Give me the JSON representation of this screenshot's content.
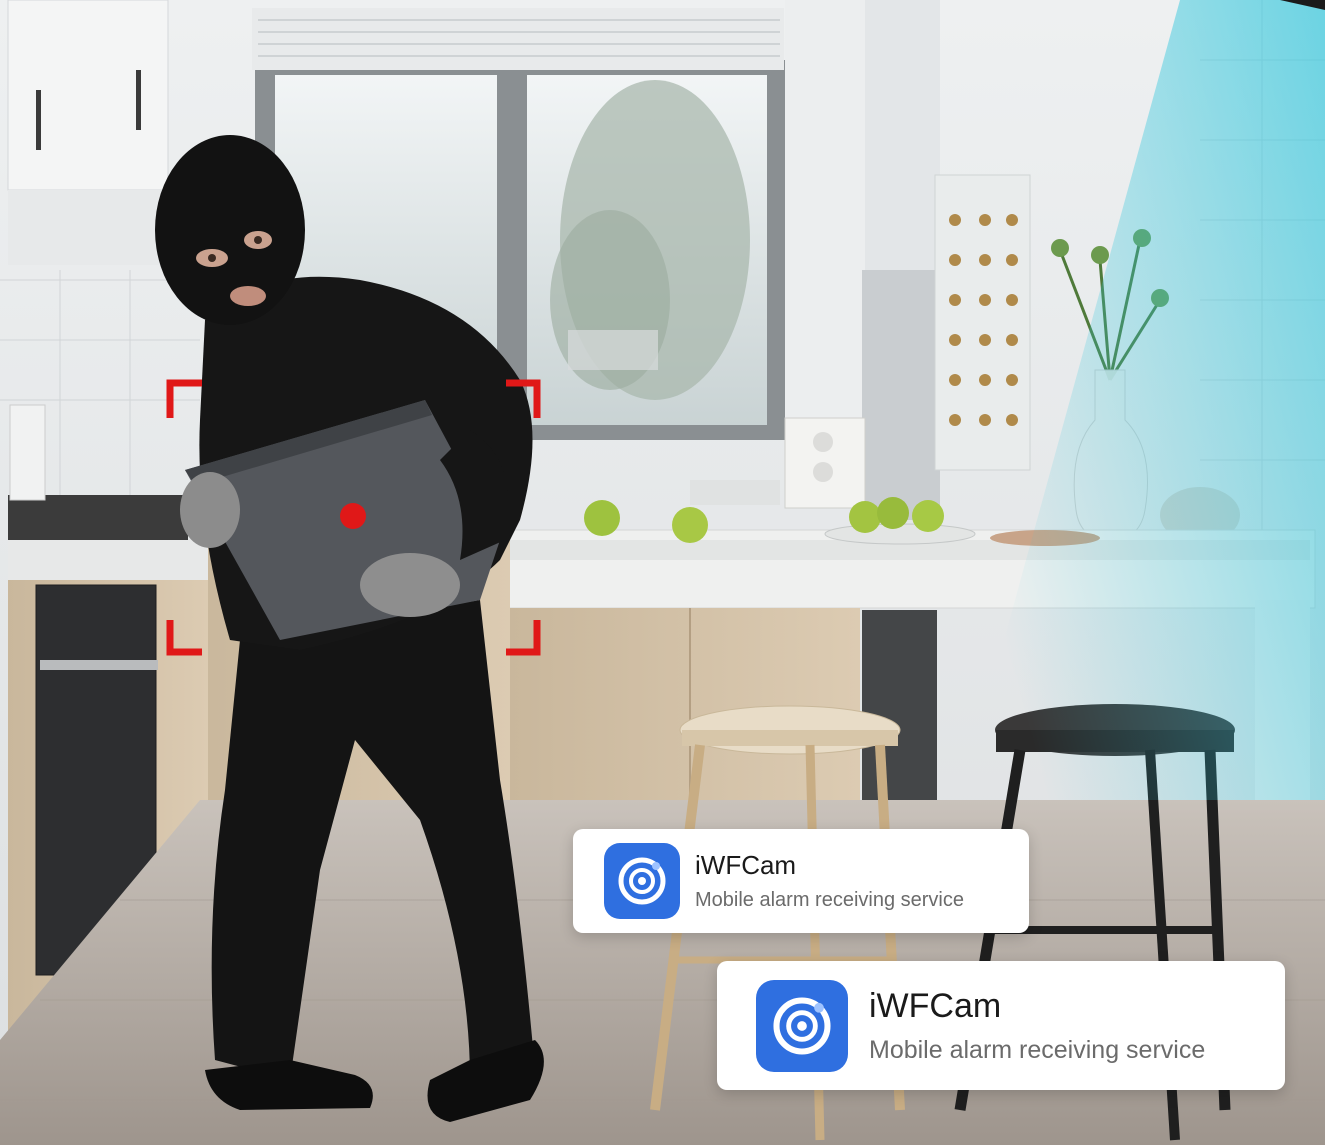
{
  "notifications": [
    {
      "app_name": "iWFCam",
      "subtitle": "Mobile alarm receiving service",
      "icon": "camera-lens-icon"
    },
    {
      "app_name": "iWFCam",
      "subtitle": "Mobile alarm receiving service",
      "icon": "camera-lens-icon"
    }
  ],
  "colors": {
    "icon_bg": "#2f6fe0",
    "detection_frame": "#e01818",
    "camera_beam": "#2ec6dc"
  },
  "scene": {
    "subject": "masked-burglar-icon",
    "detection": "motion-detection-frame-icon"
  }
}
